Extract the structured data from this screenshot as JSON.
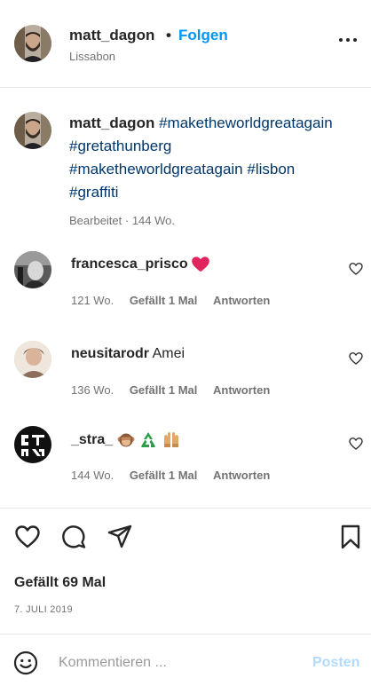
{
  "header": {
    "username": "matt_dagon",
    "separator": "•",
    "follow_label": "Folgen",
    "location": "Lissabon"
  },
  "caption": {
    "username": "matt_dagon",
    "hashtags": [
      "#maketheworldgreatagain",
      "#gretathunberg",
      "#maketheworldgreatagain",
      "#lisbon",
      "#graffiti"
    ],
    "meta": "Bearbeitet · 144 Wo."
  },
  "comments": [
    {
      "username": "francesca_prisco",
      "text": "",
      "emoji": [
        "red-heart"
      ],
      "age": "121 Wo.",
      "likes": "Gefällt 1 Mal",
      "reply": "Antworten"
    },
    {
      "username": "neusitarodr",
      "text": "Amei",
      "emoji": [],
      "age": "136 Wo.",
      "likes": "Gefällt 1 Mal",
      "reply": "Antworten"
    },
    {
      "username": "_stra_",
      "text": "",
      "emoji": [
        "monkey",
        "recycling-symbol",
        "raised-hands"
      ],
      "age": "144 Wo.",
      "likes": "Gefällt 1 Mal",
      "reply": "Antworten"
    }
  ],
  "footer": {
    "likes_count": "Gefällt 69 Mal",
    "date": "7. JULI 2019"
  },
  "comment_bar": {
    "placeholder": "Kommentieren ...",
    "post_label": "Posten"
  },
  "icons": {
    "more": "more-dots-icon",
    "like": "heart-icon",
    "comment": "comment-bubble-icon",
    "share": "paper-plane-icon",
    "save": "bookmark-icon",
    "emoji": "smiley-icon",
    "comment_like": "heart-icon"
  },
  "colors": {
    "follow_blue": "#0095f6",
    "hashtag_blue": "#00376b",
    "post_disabled_blue": "#b3dbff",
    "heart_red": "#e0245e",
    "meta_grey": "#737373"
  }
}
